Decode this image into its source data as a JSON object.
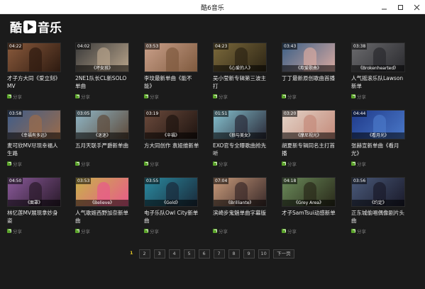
{
  "window": {
    "title": "酷6音乐"
  },
  "logo": {
    "text": "酷 音乐"
  },
  "videos": [
    {
      "duration": "04:22",
      "caption": "",
      "title": "才子方大同《爱立刻》MV",
      "share": "分享",
      "bg": "#8a5a3c",
      "fg": "#2d1a10"
    },
    {
      "duration": "04:02",
      "caption": "《坏女孩》",
      "title": "2NE1队长CL新SOLO单曲",
      "share": "分享",
      "bg": "#3a3a3a",
      "fg": "#b7a38a"
    },
    {
      "duration": "03:53",
      "caption": "",
      "title": "李玟最新单曲《能不能》",
      "share": "分享",
      "bg": "#caa08a",
      "fg": "#7f5a3e"
    },
    {
      "duration": "04:23",
      "caption": "《心爱的人》",
      "title": "吴小莹新专辑第三波主打",
      "share": "分享",
      "bg": "#7c6a3c",
      "fg": "#2c2414"
    },
    {
      "duration": "03:43",
      "caption": "《欺爱歌曲》",
      "title": "丁丁最新原创歌曲首播",
      "share": "分享",
      "bg": "#3b5f86",
      "fg": "#d8a9a0"
    },
    {
      "duration": "03:38",
      "caption": "《Brokenhearted》",
      "title": "人气摇滚乐队Lawson新单",
      "share": "分享",
      "bg": "#6b6b6e",
      "fg": "#2a2a2e"
    },
    {
      "duration": "03:58",
      "caption": "《幸福有多远》",
      "title": "麦可欣MV尽现幸福人生路",
      "share": "分享",
      "bg": "#3f5d8a",
      "fg": "#9a6b4a"
    },
    {
      "duration": "03:05",
      "caption": "《迷迷》",
      "title": "五月天联手严爵新单曲",
      "share": "分享",
      "bg": "#8fb6c6",
      "fg": "#5e4a3a"
    },
    {
      "duration": "03:19",
      "caption": "《辛福》",
      "title": "方大同创作 袁娅维新单",
      "share": "分享",
      "bg": "#6b4a3c",
      "fg": "#1e1410"
    },
    {
      "duration": "01:51",
      "caption": "《狼与美女》",
      "title": "EXO官专全曝歌曲抢先听",
      "share": "分享",
      "bg": "#86c2d0",
      "fg": "#2a2a38"
    },
    {
      "duration": "03:20",
      "caption": "《摩尼视光》",
      "title": "胡夏新专辑同名主打首播",
      "share": "分享",
      "bg": "#e3d4c8",
      "fg": "#c48a7a"
    },
    {
      "duration": "04:44",
      "caption": "《看月光》",
      "title": "张赫宣新单曲《看月光》",
      "share": "分享",
      "bg": "#1f3a8a",
      "fg": "#4a78c8"
    },
    {
      "duration": "04:50",
      "caption": "《面罩》",
      "title": "林忆莲MV展现拿妙身姿",
      "share": "分享",
      "bg": "#8a5a9a",
      "fg": "#2a1a2a"
    },
    {
      "duration": "03:53",
      "caption": "《Believe》",
      "title": "人气歌姬西野加奈新单曲",
      "share": "分享",
      "bg": "#c8b24a",
      "fg": "#e85a8a"
    },
    {
      "duration": "03:55",
      "caption": "《Gold》",
      "title": "电子乐队Owl City新单曲",
      "share": "分享",
      "bg": "#2a8aa0",
      "fg": "#1a2a3a"
    },
    {
      "duration": "07:04",
      "caption": "《Brilliante》",
      "title": "滨崎步鬼魅单曲字幕版",
      "share": "分享",
      "bg": "#c89a7a",
      "fg": "#3a2a2a"
    },
    {
      "duration": "04:18",
      "caption": "《Grey Area》",
      "title": "才子SamTsui动感新单",
      "share": "分享",
      "bg": "#6a8a5a",
      "fg": "#2a2a1a"
    },
    {
      "duration": "03:56",
      "caption": "《约定》",
      "title": "正东城偷唱偶像剧片头曲",
      "share": "分享",
      "bg": "#4a5a7a",
      "fg": "#1a1a2a"
    }
  ],
  "pager": {
    "pages": [
      "1",
      "2",
      "3",
      "4",
      "5",
      "6",
      "7",
      "8",
      "9",
      "10"
    ],
    "current": "1",
    "next": "下一页"
  },
  "colors": {
    "background": "#1b1b1b",
    "accent_current_page": "#e1c425",
    "share_icon": "#5ba32b"
  }
}
